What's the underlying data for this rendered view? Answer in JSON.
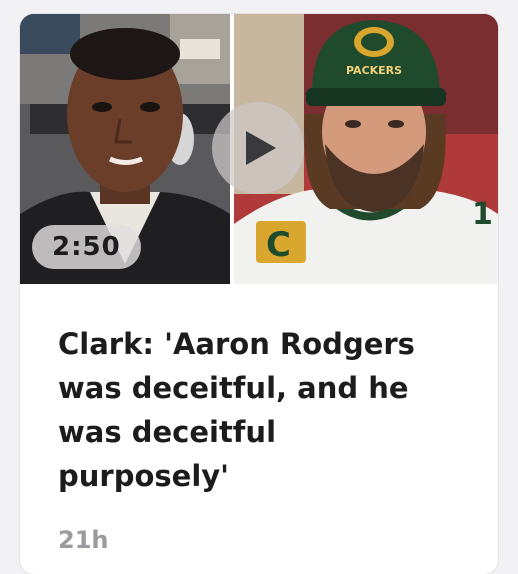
{
  "video": {
    "duration": "2:50",
    "left_image": "man-in-studio-thumbnail",
    "right_image": "football-player-packers-cap-thumbnail",
    "play_icon": "play-icon",
    "cap_text": "PACKERS",
    "jersey_patch": "C"
  },
  "article": {
    "headline": "Clark: 'Aaron Rodgers was deceitful, and he was deceitful purposely'",
    "time_ago": "21h"
  },
  "colors": {
    "card_bg": "#ffffff",
    "page_bg": "#f2f2f4",
    "headline_text": "#1c1c1e",
    "timestamp_text": "#9a9a9f",
    "packers_green": "#1f4a2c",
    "packers_gold": "#d9a62e"
  }
}
